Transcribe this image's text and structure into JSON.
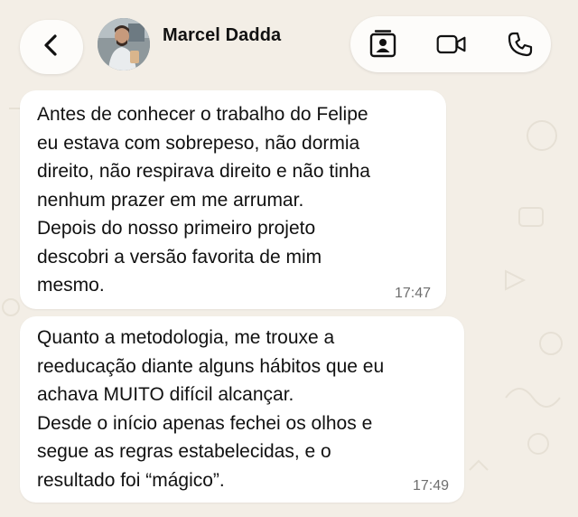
{
  "header": {
    "contact_name": "Marcel Dadda",
    "back_icon": "chevron-left-icon",
    "actions": [
      {
        "icon": "contact-card-icon"
      },
      {
        "icon": "video-call-icon"
      },
      {
        "icon": "phone-call-icon"
      }
    ]
  },
  "messages": [
    {
      "text": "Antes de conhecer o trabalho do Felipe\neu estava com sobrepeso, não dormia\ndireito, não respirava direito e não tinha\nnenhum prazer em me arrumar.\nDepois do nosso primeiro projeto\ndescobri a versão favorita de mim\nmesmo.",
      "time": "17:47"
    },
    {
      "text": "Quanto a metodologia, me trouxe a\nreeducação diante alguns hábitos que eu\nachava MUITO difícil alcançar.\nDesde o início apenas fechei os olhos e\nsegue as regras estabelecidas, e o\nresultado foi “mágico”.",
      "time": "17:49"
    }
  ],
  "colors": {
    "background": "#f3eee6",
    "bubble": "#ffffff",
    "text": "#111111",
    "timestamp": "#6e6e6e"
  }
}
